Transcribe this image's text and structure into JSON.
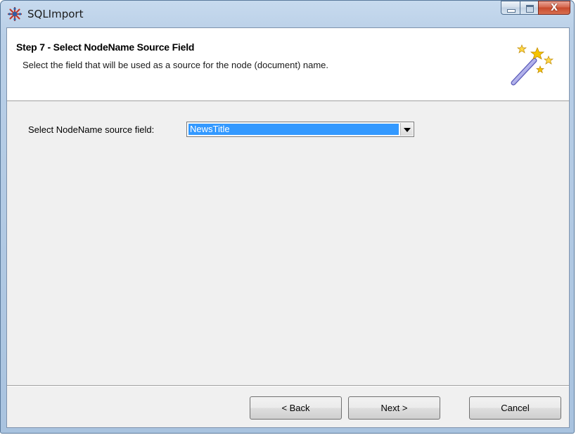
{
  "window": {
    "title": "SQLImport",
    "close_glyph": "X",
    "icons": {
      "app": "sqlimport-app-icon",
      "minimize": "minimize-icon",
      "maximize": "maximize-icon",
      "close": "close-icon"
    }
  },
  "header": {
    "title": "Step 7 - Select NodeName Source Field",
    "subtitle": "Select the field that will be used as a source for the node (document) name.",
    "icon": "magic-wand-icon"
  },
  "form": {
    "label": "Select NodeName source field:",
    "selected_value": "NewsTitle"
  },
  "buttons": {
    "back": "< Back",
    "next": "Next >",
    "cancel": "Cancel"
  },
  "colors": {
    "selection": "#3399ff",
    "dialog_bg": "#f0f0f0",
    "header_bg": "#ffffff"
  }
}
